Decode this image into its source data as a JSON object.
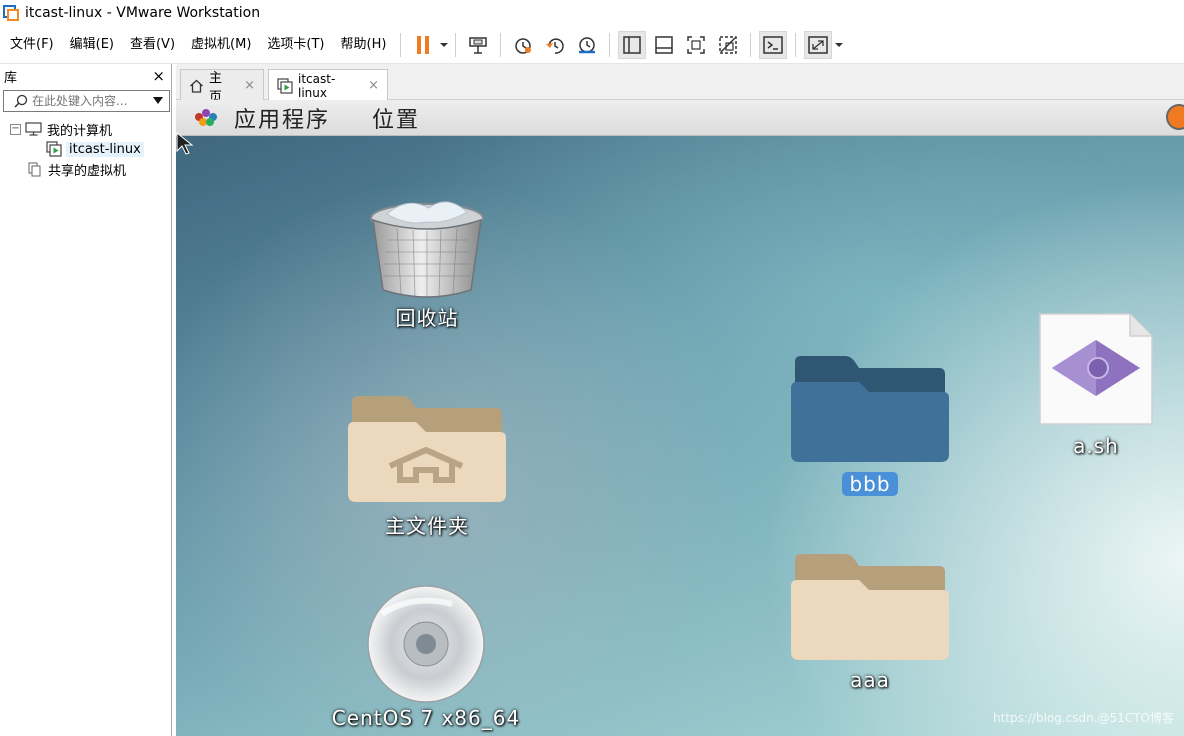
{
  "window": {
    "title": "itcast-linux - VMware Workstation"
  },
  "menu": {
    "items": [
      "文件(F)",
      "编辑(E)",
      "查看(V)",
      "虚拟机(M)",
      "选项卡(T)",
      "帮助(H)"
    ]
  },
  "toolbar": {
    "icons": [
      "pause-icon",
      "send-ctrl-alt-del-icon",
      "snapshot-icon",
      "revert-snapshot-icon",
      "snapshot-manager-icon",
      "show-library-icon",
      "thumbnail-bar-icon",
      "full-screen-icon",
      "unity-icon",
      "console-view-icon",
      "stretch-guest-icon"
    ]
  },
  "library": {
    "title": "库",
    "close": "×",
    "search_placeholder": "在此处键入内容...",
    "tree": [
      {
        "label": "我的计算机",
        "expander": "⊟"
      },
      {
        "label": "itcast-linux"
      },
      {
        "label": "共享的虚拟机"
      }
    ]
  },
  "tabs": [
    {
      "label": "主页",
      "close": "×"
    },
    {
      "label": "itcast-linux",
      "close": "×"
    }
  ],
  "guest": {
    "panel": {
      "applications": "应用程序",
      "places": "位置"
    },
    "icons": {
      "trash": "回收站",
      "home": "主文件夹",
      "dvd": "CentOS 7 x86_64",
      "bbb": "bbb",
      "aaa": "aaa",
      "script": "a.sh"
    },
    "watermark": "https://blog.csdn.@51CTO博客"
  },
  "colors": {
    "accent_orange": "#f07a22",
    "selection_blue": "#4a90d9",
    "folder_blue": "#3f7199",
    "folder_tan": "#ecd8bd"
  }
}
